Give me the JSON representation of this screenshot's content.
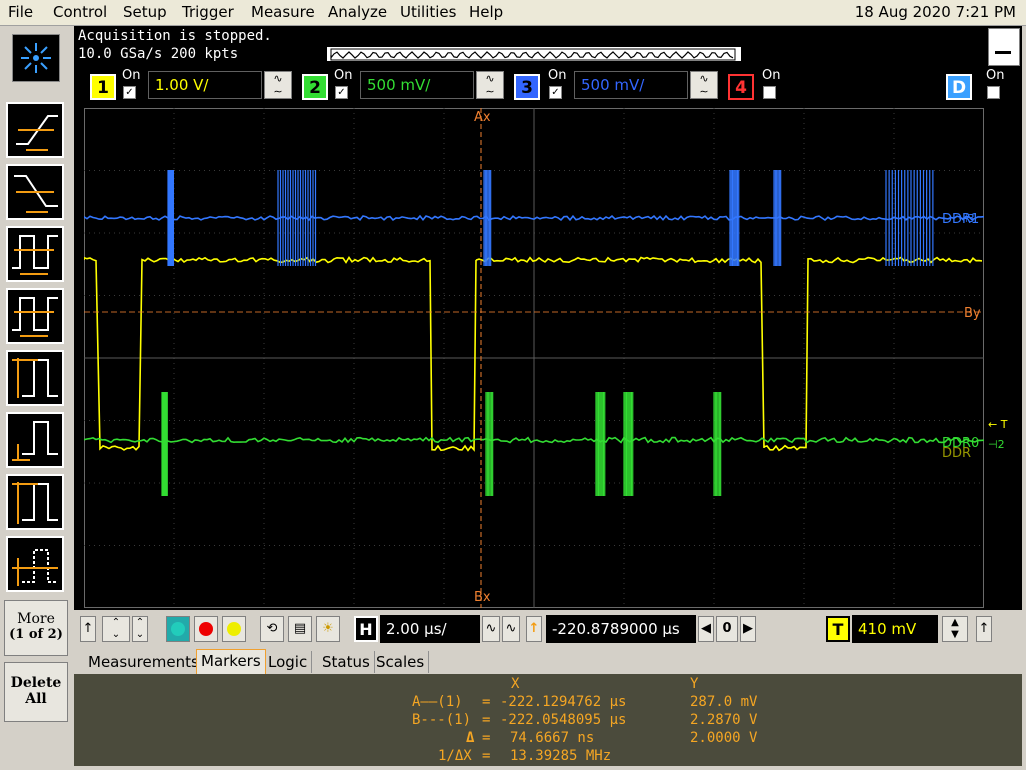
{
  "menu": [
    "File",
    "Control",
    "Setup",
    "Trigger",
    "Measure",
    "Analyze",
    "Utilities",
    "Help"
  ],
  "datetime": "18 Aug 2020  7:21 PM",
  "acquisition": {
    "status": "Acquisition is stopped.",
    "rate": "10.0 GSa/s   200 kpts"
  },
  "channels": [
    {
      "num": "1",
      "on_label": "On",
      "scale": "1.00 V/",
      "color": "#ffff00",
      "enabled": true
    },
    {
      "num": "2",
      "on_label": "On",
      "scale": "500 mV/",
      "color": "#33dd33",
      "enabled": true
    },
    {
      "num": "3",
      "on_label": "On",
      "scale": "500 mV/",
      "color": "#3366ff",
      "enabled": true
    },
    {
      "num": "4",
      "on_label": "On",
      "color": "#ff3333",
      "enabled": false
    }
  ],
  "digital": {
    "label": "D",
    "on_label": "On",
    "enabled": false
  },
  "markers": {
    "ax": "Ax",
    "bx": "Bx",
    "by": "By"
  },
  "traces": {
    "ddr1": "DDR1",
    "ddr0": "DDR0",
    "ddr0_shadow": "DDR"
  },
  "controls": {
    "timebase": "2.00 µs/",
    "delay": "-220.8789000 µs",
    "zero": "0",
    "trigger_level": "410 mV",
    "h_label": "H",
    "t_label": "T"
  },
  "sidebar": {
    "more_line1": "More",
    "more_line2": "(1 of 2)",
    "delete_line1": "Delete",
    "delete_line2": "All"
  },
  "tabs": [
    "Measurements",
    "Markers",
    "Logic",
    "Status",
    "Scales"
  ],
  "active_tab": "Markers",
  "readout": {
    "header_x": "X",
    "header_y": "Y",
    "rows": [
      {
        "label": "A——(1)",
        "eq": "=",
        "x": "-222.1294762 µs",
        "y": "287.0 mV"
      },
      {
        "label": "B---(1)",
        "eq": "=",
        "x": "-222.0548095 µs",
        "y": "2.2870 V"
      },
      {
        "label": "Δ",
        "eq": "=",
        "x": "74.6667 ns",
        "y": "2.0000 V"
      },
      {
        "label": "1/ΔX",
        "eq": "=",
        "x": "13.39285 MHz",
        "y": ""
      }
    ]
  },
  "colors": {
    "ch1": "#ffff00",
    "ch2": "#33dd33",
    "ch3": "#3377ff",
    "marker": "#f08030"
  }
}
